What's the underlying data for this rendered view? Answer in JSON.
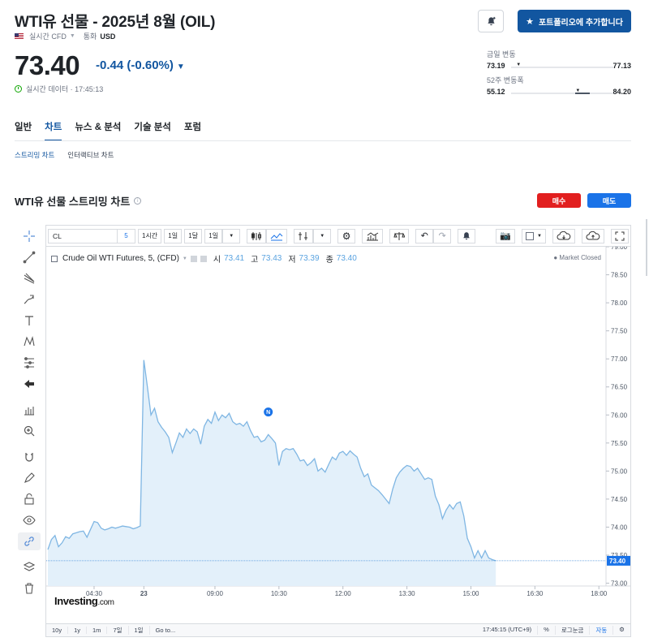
{
  "header": {
    "title": "WTI유 선물 - 2025년 8월 (OIL)",
    "market": "실시간 CFD",
    "currency_label": "통화",
    "currency": "USD",
    "portfolio_button": "포트폴리오에 추가합니다"
  },
  "quote": {
    "price": "73.40",
    "change": "-0.44 (-0.60%)",
    "status": "실시간 데이터 · 17:45:13"
  },
  "ranges": {
    "day": {
      "label": "금일 변동",
      "low": "73.19",
      "high": "77.13",
      "position": 0.05
    },
    "week52": {
      "label": "52주 변동폭",
      "low": "55.12",
      "high": "84.20",
      "position": 0.63
    }
  },
  "tabs": [
    "일반",
    "차트",
    "뉴스 & 분석",
    "기술 분석",
    "포럼"
  ],
  "subtabs": [
    "스트리밍 차트",
    "인터랙티브 차트"
  ],
  "section": {
    "title": "WTI유 선물 스트리밍 차트",
    "buy": "매수",
    "sell": "매도"
  },
  "toolbar": {
    "symbol": "CL",
    "interval": "5",
    "items": [
      "1시간",
      "1일",
      "1달",
      "1일"
    ]
  },
  "legend": {
    "name": "Crude Oil WTI Futures, 5, (CFD)",
    "o_label": "시",
    "o": "73.41",
    "h_label": "고",
    "h": "73.43",
    "l_label": "저",
    "l": "73.39",
    "c_label": "종",
    "c": "73.40",
    "status": "Market Closed"
  },
  "bottom": {
    "ranges": [
      "10y",
      "1y",
      "1m",
      "7일",
      "1일"
    ],
    "goto": "Go to...",
    "time": "17:45:15 (UTC+9)",
    "pct": "%",
    "log": "로그눈금",
    "auto": "자동"
  },
  "logo": {
    "main": "Investing",
    "suffix": ".com"
  },
  "colors": {
    "accent": "#1256a0",
    "line": "#7fb6e3",
    "fill": "#e3f0fa",
    "buy": "#e21f1f",
    "sell": "#1a73e8"
  },
  "chart_data": {
    "type": "area",
    "yticks": [
      "79.00",
      "78.50",
      "78.00",
      "77.50",
      "77.00",
      "76.50",
      "76.00",
      "75.50",
      "75.00",
      "74.50",
      "74.00",
      "73.50",
      "73.00"
    ],
    "ylim": [
      72.95,
      79.0
    ],
    "xticks": [
      {
        "label": "04:30",
        "i": 13
      },
      {
        "label": "23",
        "i": 27
      },
      {
        "label": "09:00",
        "i": 47
      },
      {
        "label": "10:30",
        "i": 65
      },
      {
        "label": "12:00",
        "i": 83
      },
      {
        "label": "13:30",
        "i": 101
      },
      {
        "label": "15:00",
        "i": 119
      },
      {
        "label": "16:30",
        "i": 137
      },
      {
        "label": "18:00",
        "i": 155
      }
    ],
    "last_price": "73.40",
    "values": [
      73.6,
      73.78,
      73.85,
      73.65,
      73.72,
      73.83,
      73.8,
      73.88,
      73.9,
      73.92,
      73.93,
      73.82,
      73.96,
      74.1,
      74.08,
      73.98,
      73.95,
      73.97,
      74.0,
      73.98,
      74.0,
      74.02,
      74.01,
      74.0,
      73.97,
      73.99,
      74.02,
      76.98,
      76.5,
      76.0,
      76.12,
      75.88,
      75.78,
      75.7,
      75.6,
      75.33,
      75.5,
      75.68,
      75.6,
      75.75,
      75.67,
      75.75,
      75.7,
      75.48,
      75.8,
      75.92,
      75.85,
      76.05,
      75.9,
      76.0,
      75.95,
      76.03,
      75.88,
      75.83,
      75.85,
      75.8,
      75.88,
      75.72,
      75.6,
      75.62,
      75.52,
      75.55,
      75.65,
      75.58,
      75.5,
      75.1,
      75.35,
      75.4,
      75.38,
      75.4,
      75.3,
      75.18,
      75.2,
      75.1,
      75.15,
      75.22,
      75.0,
      75.05,
      74.98,
      75.12,
      75.25,
      75.2,
      75.32,
      75.35,
      75.28,
      75.36,
      75.3,
      75.25,
      75.05,
      74.9,
      74.95,
      74.75,
      74.7,
      74.65,
      74.58,
      74.5,
      74.42,
      74.68,
      74.88,
      74.98,
      75.05,
      75.1,
      75.08,
      75.0,
      75.05,
      74.95,
      74.85,
      74.88,
      74.85,
      74.55,
      74.4,
      74.15,
      74.3,
      74.4,
      74.32,
      74.42,
      74.45,
      74.2,
      73.8,
      73.65,
      73.45,
      73.58,
      73.45,
      73.58,
      73.45,
      73.42,
      73.4
    ]
  }
}
